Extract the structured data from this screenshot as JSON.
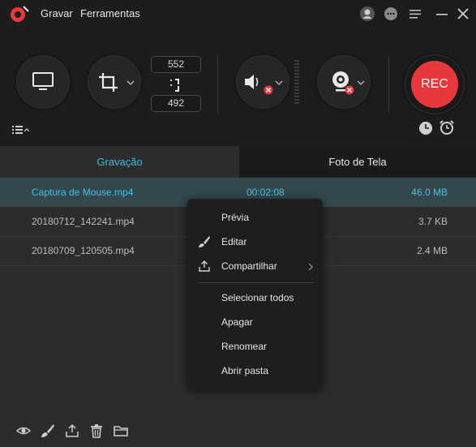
{
  "titlebar": {
    "menus": [
      "Gravar",
      "Ferramentas"
    ]
  },
  "controls": {
    "width_value": "552",
    "height_value": "492",
    "rec_label": "REC"
  },
  "tabs": {
    "recording": "Gravação",
    "screenshot": "Foto de Tela"
  },
  "files": [
    {
      "name": "Captura de Mouse.mp4",
      "duration": "00:02:08",
      "size": "46.0 MB"
    },
    {
      "name": "20180712_142241.mp4",
      "duration": "",
      "size": "3.7 KB"
    },
    {
      "name": "20180709_120505.mp4",
      "duration": "",
      "size": "2.4 MB"
    }
  ],
  "context_menu": {
    "preview": "Prévia",
    "edit": "Editar",
    "share": "Compartilhar",
    "select_all": "Selecionar todos",
    "delete": "Apagar",
    "rename": "Renomear",
    "open_folder": "Abrir pasta"
  },
  "colors": {
    "accent": "#40b8d8",
    "rec": "#e8383d",
    "background": "#2c2c2c",
    "panel": "#1d1d1d"
  }
}
